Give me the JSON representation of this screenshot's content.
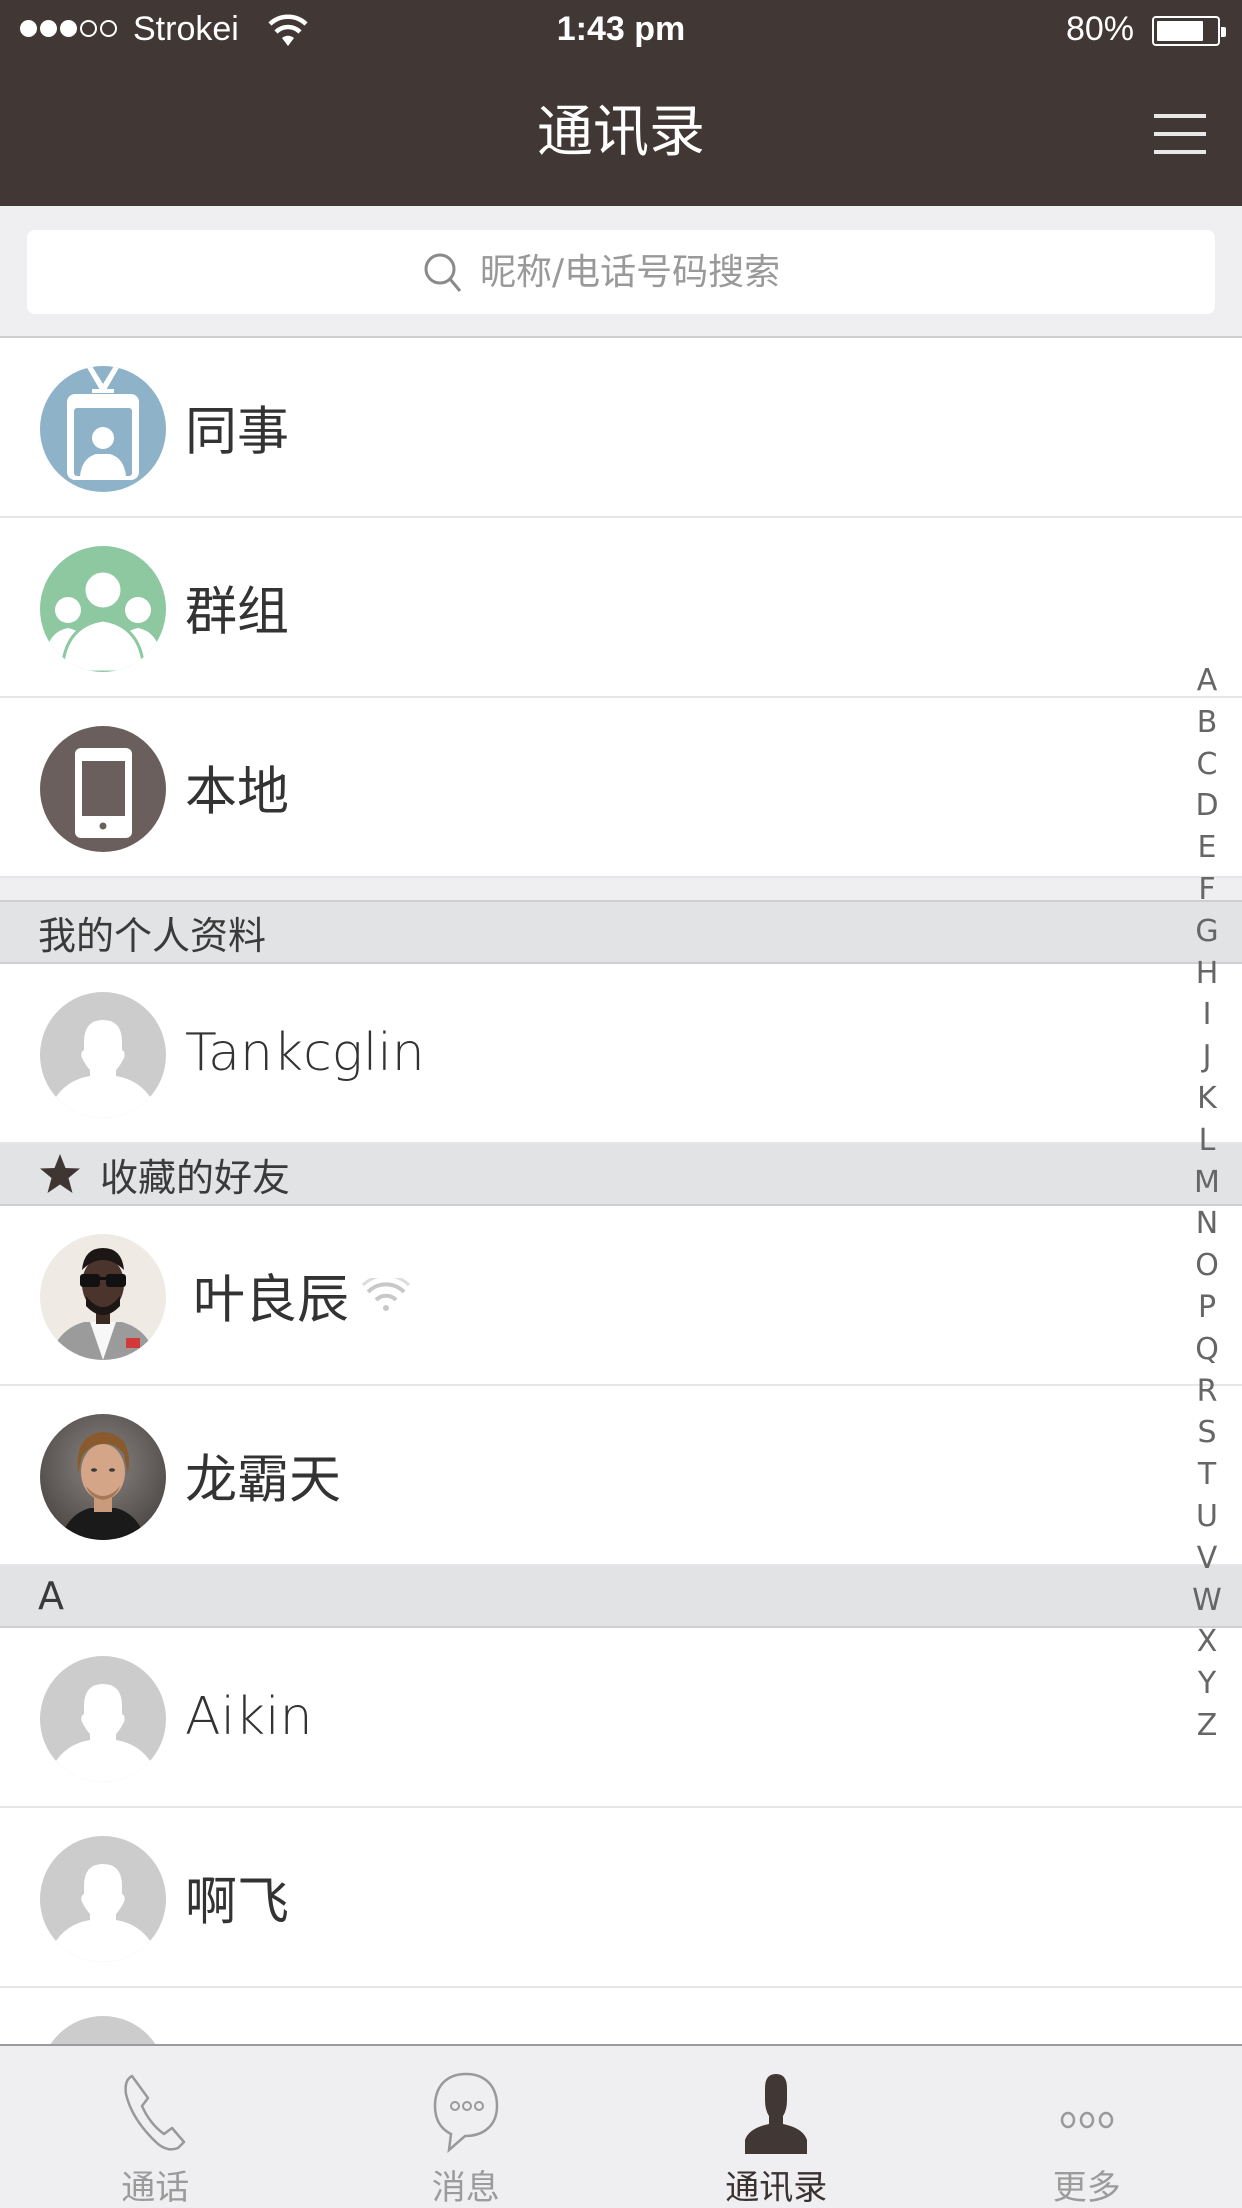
{
  "status_bar": {
    "carrier": "Strokei",
    "signal_bars_filled": 3,
    "signal_bars_total": 5,
    "time": "1:43 pm",
    "battery_percent_label": "80%",
    "battery_level": 0.8
  },
  "nav": {
    "title": "通讯录",
    "menu_icon": "hamburger-menu-icon"
  },
  "search": {
    "placeholder": "昵称/电话号码搜索",
    "value": ""
  },
  "categories": [
    {
      "label": "同事",
      "icon": "id-badge-icon",
      "color": "#8eb2c8"
    },
    {
      "label": "群组",
      "icon": "group-icon",
      "color": "#8dc8a0"
    },
    {
      "label": "本地",
      "icon": "phone-device-icon",
      "color": "#6b5f5e"
    }
  ],
  "sections": {
    "my_profile": {
      "title": "我的个人资料",
      "contacts": [
        {
          "name": "Tankcglin",
          "avatar": "default-avatar"
        }
      ]
    },
    "favorites": {
      "title": "收藏的好友",
      "icon": "star-icon",
      "contacts": [
        {
          "name": "叶良辰",
          "avatar": "photo-sunglasses-man",
          "online": true
        },
        {
          "name": "龙霸天",
          "avatar": "photo-blond-man"
        }
      ]
    },
    "a": {
      "title": "A",
      "contacts": [
        {
          "name": "Aikin",
          "avatar": "default-avatar"
        },
        {
          "name": "啊飞",
          "avatar": "default-avatar"
        },
        {
          "name": "",
          "avatar": "default-avatar"
        }
      ]
    }
  },
  "index_letters": [
    "A",
    "B",
    "C",
    "D",
    "E",
    "F",
    "G",
    "H",
    "I",
    "J",
    "K",
    "L",
    "M",
    "N",
    "O",
    "P",
    "Q",
    "R",
    "S",
    "T",
    "U",
    "V",
    "W",
    "X",
    "Y",
    "Z"
  ],
  "tabs": [
    {
      "label": "通话",
      "icon": "phone-icon",
      "active": false
    },
    {
      "label": "消息",
      "icon": "chat-bubble-icon",
      "active": false
    },
    {
      "label": "通讯录",
      "icon": "contacts-person-icon",
      "active": true
    },
    {
      "label": "更多",
      "icon": "more-dots-icon",
      "active": false
    }
  ],
  "colors": {
    "nav_bg": "#413735",
    "section_bg": "#e2e3e5",
    "page_bg": "#efeff1",
    "active_tab": "#3a3231",
    "inactive_tab": "#9b9b9b"
  }
}
